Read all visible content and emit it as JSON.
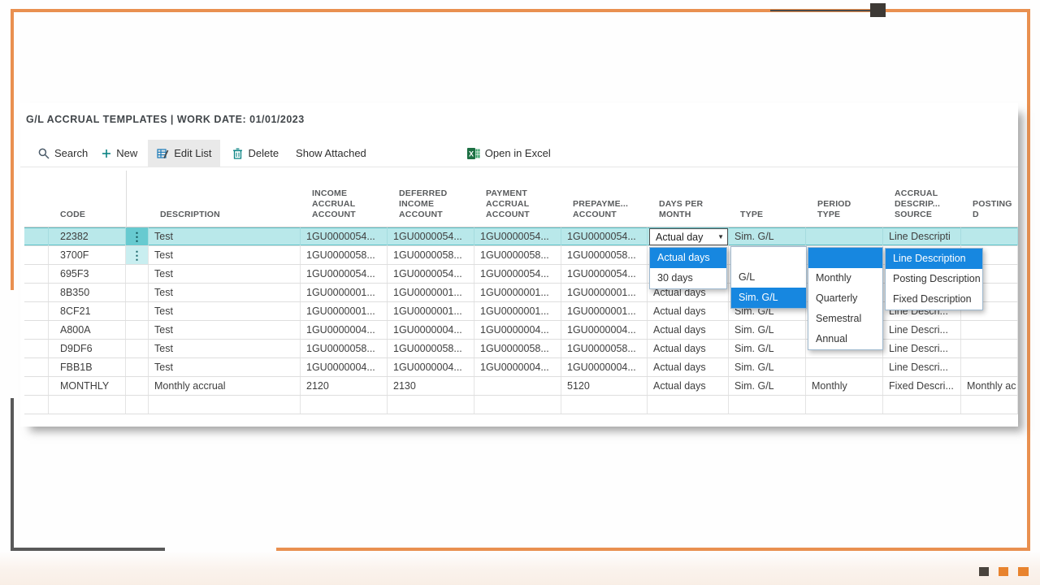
{
  "colors": {
    "frame_orange": "#e99050",
    "accent_dark_square": "#4a443e",
    "selection_teal": "#b9e8ea",
    "dropdown_highlight_blue": "#1787e0",
    "excel_green": "#1d7044",
    "toolbar_icon_teal": "#0b8484"
  },
  "page": {
    "title": "G/L ACCRUAL TEMPLATES | WORK DATE: 01/01/2023"
  },
  "toolbar": {
    "search": "Search",
    "new": "New",
    "edit_list": "Edit List",
    "delete": "Delete",
    "show_attached": "Show Attached",
    "open_in_excel": "Open in Excel"
  },
  "table": {
    "columns": [
      {
        "key": "sel",
        "label": "",
        "width": 30
      },
      {
        "key": "code",
        "label": "CODE",
        "width": 95
      },
      {
        "key": "ell",
        "label": "",
        "width": 28
      },
      {
        "key": "desc",
        "label": "DESCRIPTION",
        "width": 187
      },
      {
        "key": "income",
        "label": "INCOME\nACCRUAL\nACCOUNT",
        "width": 107
      },
      {
        "key": "deferred",
        "label": "DEFERRED\nINCOME\nACCOUNT",
        "width": 107
      },
      {
        "key": "payment",
        "label": "PAYMENT\nACCRUAL\nACCOUNT",
        "width": 107
      },
      {
        "key": "prepay",
        "label": "PREPAYME...\nACCOUNT",
        "width": 106
      },
      {
        "key": "days",
        "label": "DAYS PER\nMONTH",
        "width": 100
      },
      {
        "key": "type",
        "label": "TYPE",
        "width": 95
      },
      {
        "key": "period",
        "label": "PERIOD\nTYPE",
        "width": 95
      },
      {
        "key": "source",
        "label": "ACCRUAL\nDESCRIP...\nSOURCE",
        "width": 96
      },
      {
        "key": "posting",
        "label": "POSTING D",
        "width": 70
      }
    ],
    "rows": [
      {
        "code": "22382",
        "ellipsis": true,
        "selected": true,
        "desc": "Test",
        "income": "1GU0000054...",
        "deferred": "1GU0000054...",
        "payment": "1GU0000054...",
        "prepay": "1GU0000054...",
        "days": "",
        "type": "Sim. G/L",
        "period": "",
        "source": "Line Descripti",
        "posting": ""
      },
      {
        "code": "3700F",
        "ellipsis": true,
        "desc": "Test",
        "income": "1GU0000058...",
        "deferred": "1GU0000058...",
        "payment": "1GU0000058...",
        "prepay": "1GU0000058...",
        "days": "",
        "type": "",
        "period": "",
        "source": "",
        "posting": ""
      },
      {
        "code": "695F3",
        "desc": "Test",
        "income": "1GU0000054...",
        "deferred": "1GU0000054...",
        "payment": "1GU0000054...",
        "prepay": "1GU0000054...",
        "days": "",
        "type": "",
        "period": "",
        "source": "",
        "posting": ""
      },
      {
        "code": "8B350",
        "desc": "Test",
        "income": "1GU0000001...",
        "deferred": "1GU0000001...",
        "payment": "1GU0000001...",
        "prepay": "1GU0000001...",
        "days": "Actual days",
        "type": "",
        "period": "",
        "source": "",
        "posting": ""
      },
      {
        "code": "8CF21",
        "desc": "Test",
        "income": "1GU0000001...",
        "deferred": "1GU0000001...",
        "payment": "1GU0000001...",
        "prepay": "1GU0000001...",
        "days": "Actual days",
        "type": "Sim. G/L",
        "period": "",
        "source": "Line Descri...",
        "posting": ""
      },
      {
        "code": "A800A",
        "desc": "Test",
        "income": "1GU0000004...",
        "deferred": "1GU0000004...",
        "payment": "1GU0000004...",
        "prepay": "1GU0000004...",
        "days": "Actual days",
        "type": "Sim. G/L",
        "period": "",
        "source": "Line Descri...",
        "posting": ""
      },
      {
        "code": "D9DF6",
        "desc": "Test",
        "income": "1GU0000058...",
        "deferred": "1GU0000058...",
        "payment": "1GU0000058...",
        "prepay": "1GU0000058...",
        "days": "Actual days",
        "type": "Sim. G/L",
        "period": "",
        "source": "Line Descri...",
        "posting": ""
      },
      {
        "code": "FBB1B",
        "desc": "Test",
        "income": "1GU0000004...",
        "deferred": "1GU0000004...",
        "payment": "1GU0000004...",
        "prepay": "1GU0000004...",
        "days": "Actual days",
        "type": "Sim. G/L",
        "period": "",
        "source": "Line Descri...",
        "posting": ""
      },
      {
        "code": "MONTHLY",
        "desc": "Monthly accrual",
        "income": "2120",
        "deferred": "2130",
        "payment": "",
        "prepay": "5120",
        "days": "Actual days",
        "type": "Sim. G/L",
        "period": "Monthly",
        "source": "Fixed Descri...",
        "posting": "Monthly ac"
      },
      {
        "code": "",
        "desc": "",
        "income": "",
        "deferred": "",
        "payment": "",
        "prepay": "",
        "days": "",
        "type": "",
        "period": "",
        "source": "",
        "posting": ""
      }
    ]
  },
  "dropdowns": {
    "days_combo": {
      "value": "Actual day"
    },
    "days_list": {
      "items": [
        "Actual days",
        "30 days"
      ],
      "selected": 0
    },
    "type_list": {
      "items": [
        "",
        "G/L",
        "Sim. G/L"
      ],
      "selected": 2
    },
    "period_list": {
      "items": [
        "",
        "Monthly",
        "Quarterly",
        "Semestral",
        "Annual"
      ],
      "selected": 0
    },
    "source_list": {
      "items": [
        "Line Description",
        "Posting Description",
        "Fixed Description"
      ],
      "selected": 0
    }
  }
}
